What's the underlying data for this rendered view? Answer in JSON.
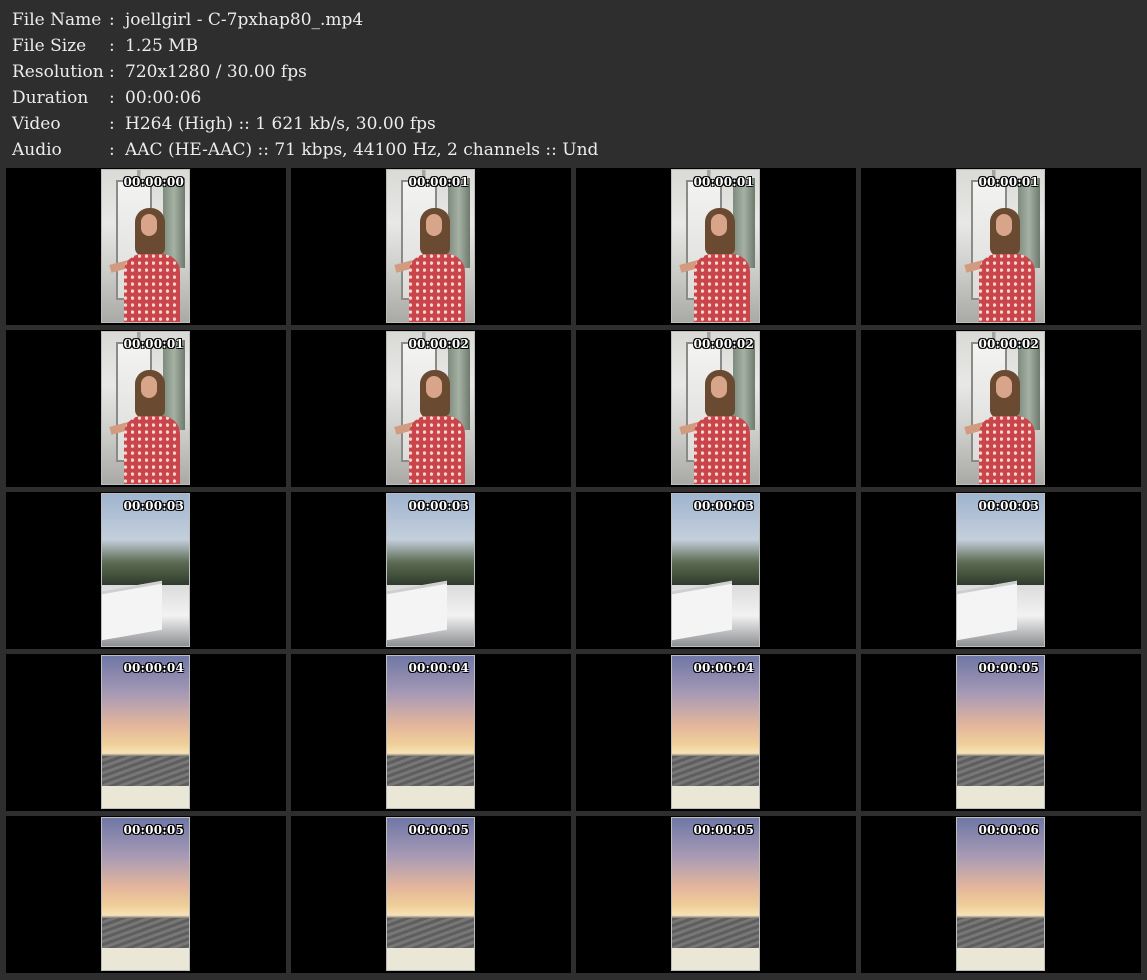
{
  "meta": {
    "file_name": {
      "label": "File Name",
      "sep": ":",
      "value": "joellgirl - C-7pxhap80_.mp4"
    },
    "file_size": {
      "label": "File Size",
      "sep": ":",
      "value": "1.25 MB"
    },
    "resolution": {
      "label": "Resolution",
      "sep": ":",
      "value": "720x1280 / 30.00 fps"
    },
    "duration": {
      "label": "Duration",
      "sep": ":",
      "value": "00:00:06"
    },
    "video": {
      "label": "Video",
      "sep": ":",
      "value": "H264 (High) :: 1 621 kb/s, 30.00 fps"
    },
    "audio": {
      "label": "Audio",
      "sep": ":",
      "value": "AAC (HE-AAC) :: 71 kbps, 44100 Hz, 2 channels :: Und"
    }
  },
  "thumbnails": [
    {
      "timestamp": "00:00:00",
      "scene": "room"
    },
    {
      "timestamp": "00:00:01",
      "scene": "room"
    },
    {
      "timestamp": "00:00:01",
      "scene": "room"
    },
    {
      "timestamp": "00:00:01",
      "scene": "room"
    },
    {
      "timestamp": "00:00:01",
      "scene": "room"
    },
    {
      "timestamp": "00:00:02",
      "scene": "room"
    },
    {
      "timestamp": "00:00:02",
      "scene": "room"
    },
    {
      "timestamp": "00:00:02",
      "scene": "room"
    },
    {
      "timestamp": "00:00:03",
      "scene": "hill"
    },
    {
      "timestamp": "00:00:03",
      "scene": "hill"
    },
    {
      "timestamp": "00:00:03",
      "scene": "hill"
    },
    {
      "timestamp": "00:00:03",
      "scene": "hill"
    },
    {
      "timestamp": "00:00:04",
      "scene": "sunset"
    },
    {
      "timestamp": "00:00:04",
      "scene": "sunset"
    },
    {
      "timestamp": "00:00:04",
      "scene": "sunset"
    },
    {
      "timestamp": "00:00:05",
      "scene": "sunset"
    },
    {
      "timestamp": "00:00:05",
      "scene": "sunset"
    },
    {
      "timestamp": "00:00:05",
      "scene": "sunset"
    },
    {
      "timestamp": "00:00:05",
      "scene": "sunset"
    },
    {
      "timestamp": "00:00:06",
      "scene": "sunset"
    }
  ]
}
